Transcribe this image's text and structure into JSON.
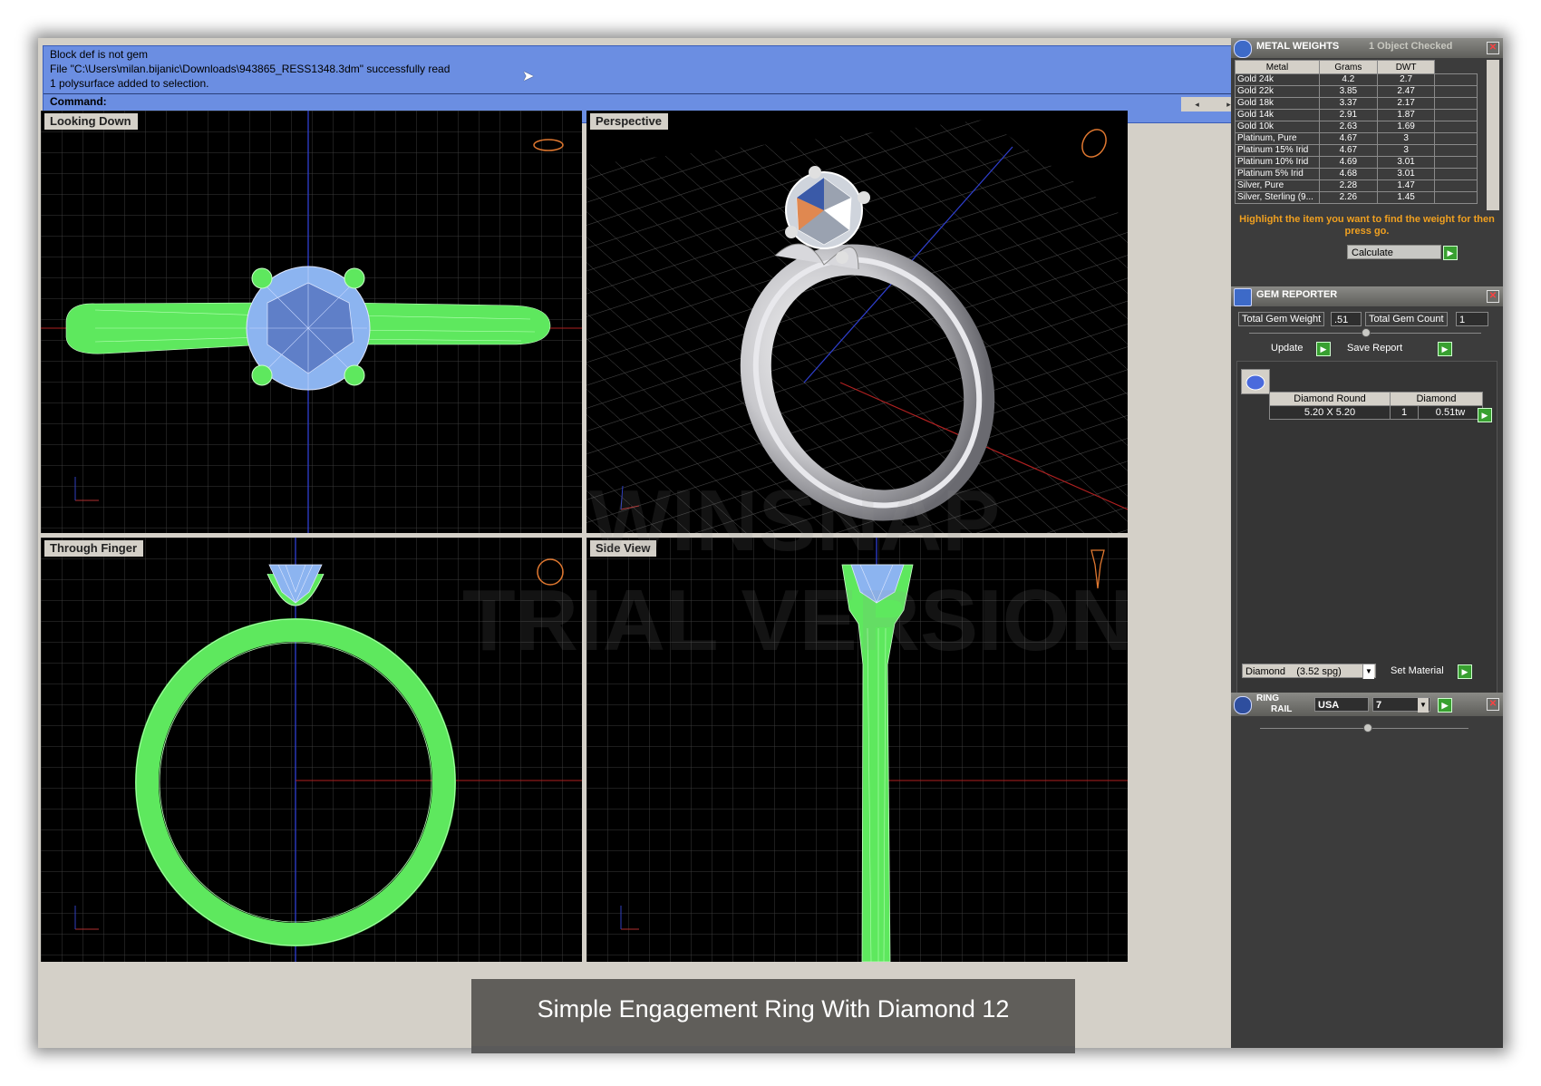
{
  "command_area": {
    "lines": [
      "Block def is not gem",
      "File \"C:\\Users\\milan.bijanic\\Downloads\\943865_RESS1348.3dm\" successfully read",
      "1 polysurface added to selection."
    ],
    "command_label": "Command:"
  },
  "viewports": {
    "top_left": "Looking Down",
    "top_right": "Perspective",
    "bottom_left": "Through Finger",
    "bottom_right": "Side View"
  },
  "metal_weights": {
    "title": "METAL WEIGHTS",
    "status": "1 Object Checked",
    "columns": [
      "Metal",
      "Grams",
      "DWT"
    ],
    "rows": [
      [
        "Gold 24k",
        "4.2",
        "2.7"
      ],
      [
        "Gold 22k",
        "3.85",
        "2.47"
      ],
      [
        "Gold 18k",
        "3.37",
        "2.17"
      ],
      [
        "Gold 14k",
        "2.91",
        "1.87"
      ],
      [
        "Gold 10k",
        "2.63",
        "1.69"
      ],
      [
        "Platinum, Pure",
        "4.67",
        "3"
      ],
      [
        "Platinum 15% Irid",
        "4.67",
        "3"
      ],
      [
        "Platinum 10% Irid",
        "4.69",
        "3.01"
      ],
      [
        "Platinum 5% Irid",
        "4.68",
        "3.01"
      ],
      [
        "Silver, Pure",
        "2.28",
        "1.47"
      ],
      [
        "Silver, Sterling (9...",
        "2.26",
        "1.45"
      ]
    ],
    "hint": "Highlight the item you want to find the weight for then press go.",
    "calculate_label": "Calculate"
  },
  "gem_reporter": {
    "title": "GEM REPORTER",
    "total_weight_label": "Total Gem Weight",
    "total_weight_value": ".51",
    "total_count_label": "Total Gem Count",
    "total_count_value": "1",
    "update_label": "Update",
    "save_report_label": "Save Report",
    "table_headers": [
      "Diamond Round",
      "Diamond"
    ],
    "gem_row": {
      "size": "5.20 X 5.20",
      "count": "1",
      "weight": "0.51tw"
    },
    "material_select": "Diamond    (3.52 spg)",
    "set_material_label": "Set Material"
  },
  "ring_rail": {
    "title_line1": "RING",
    "title_line2": "RAIL",
    "country": "USA",
    "size": "7"
  },
  "watermark": {
    "line1": "WINSNAP",
    "line2": "TRIAL VERSION"
  },
  "caption": "Simple Engagement Ring With Diamond 12",
  "colors": {
    "wireframe": "#5ee85e",
    "gem": "#8cb4f0",
    "command_bg": "#6b8ee2",
    "accent_orange": "#f0a020"
  },
  "icons": [
    "metal-weights-icon",
    "gem-reporter-icon",
    "ring-rail-icon",
    "close-icon",
    "go-arrow-icon",
    "dropdown-arrow-icon"
  ]
}
